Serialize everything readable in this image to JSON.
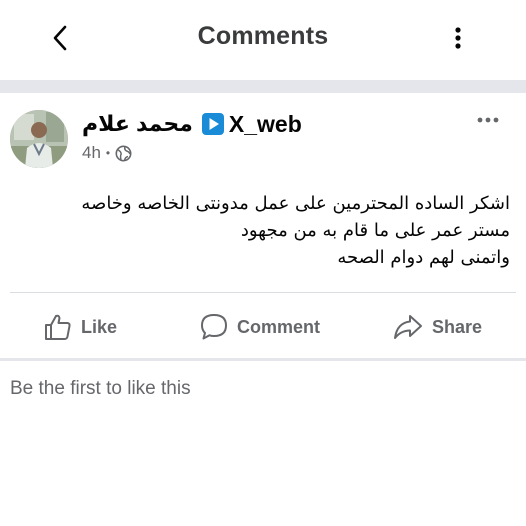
{
  "header": {
    "title": "Comments",
    "back_icon": "chevron-left-icon",
    "more_icon": "vertical-ellipsis-icon"
  },
  "post": {
    "author_name": "محمد علام",
    "page_name": "X_web",
    "page_icon": "play-button-icon",
    "timestamp": "4h",
    "separator": "•",
    "privacy_icon": "globe-icon",
    "more_icon": "horizontal-ellipsis-icon",
    "text_lines": [
      "اشكر الساده المحترمين على عمل مدونتى الخاصه وخاصه",
      "مستر عمر على ما قام به من مجهود",
      "واتمنى لهم دوام الصحه"
    ]
  },
  "actions": {
    "like_label": "Like",
    "comment_label": "Comment",
    "share_label": "Share"
  },
  "reactions": {
    "empty_text": "Be the first to like this"
  },
  "colors": {
    "secondary_text": "#65676b",
    "divider": "#e4e6eb",
    "play_icon_blue": "#1a8bd6"
  }
}
